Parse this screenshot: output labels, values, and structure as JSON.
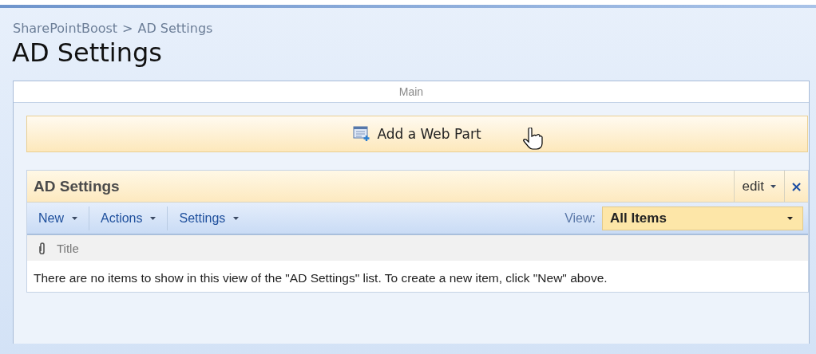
{
  "breadcrumb": {
    "items": [
      "SharePointBoost",
      "AD Settings"
    ],
    "separator": ">"
  },
  "page_title": "AD Settings",
  "zone": {
    "title": "Main",
    "add_web_part": "Add a Web Part"
  },
  "web_part": {
    "title": "AD Settings",
    "edit_menu": "edit",
    "close": "×",
    "toolbar": [
      {
        "label": "New"
      },
      {
        "label": "Actions"
      },
      {
        "label": "Settings"
      }
    ],
    "view_label": "View:",
    "view_value": "All Items",
    "columns": [
      "Title"
    ],
    "empty_message": "There are no items to show in this view of the \"AD Settings\" list. To create a new item, click \"New\" above."
  }
}
